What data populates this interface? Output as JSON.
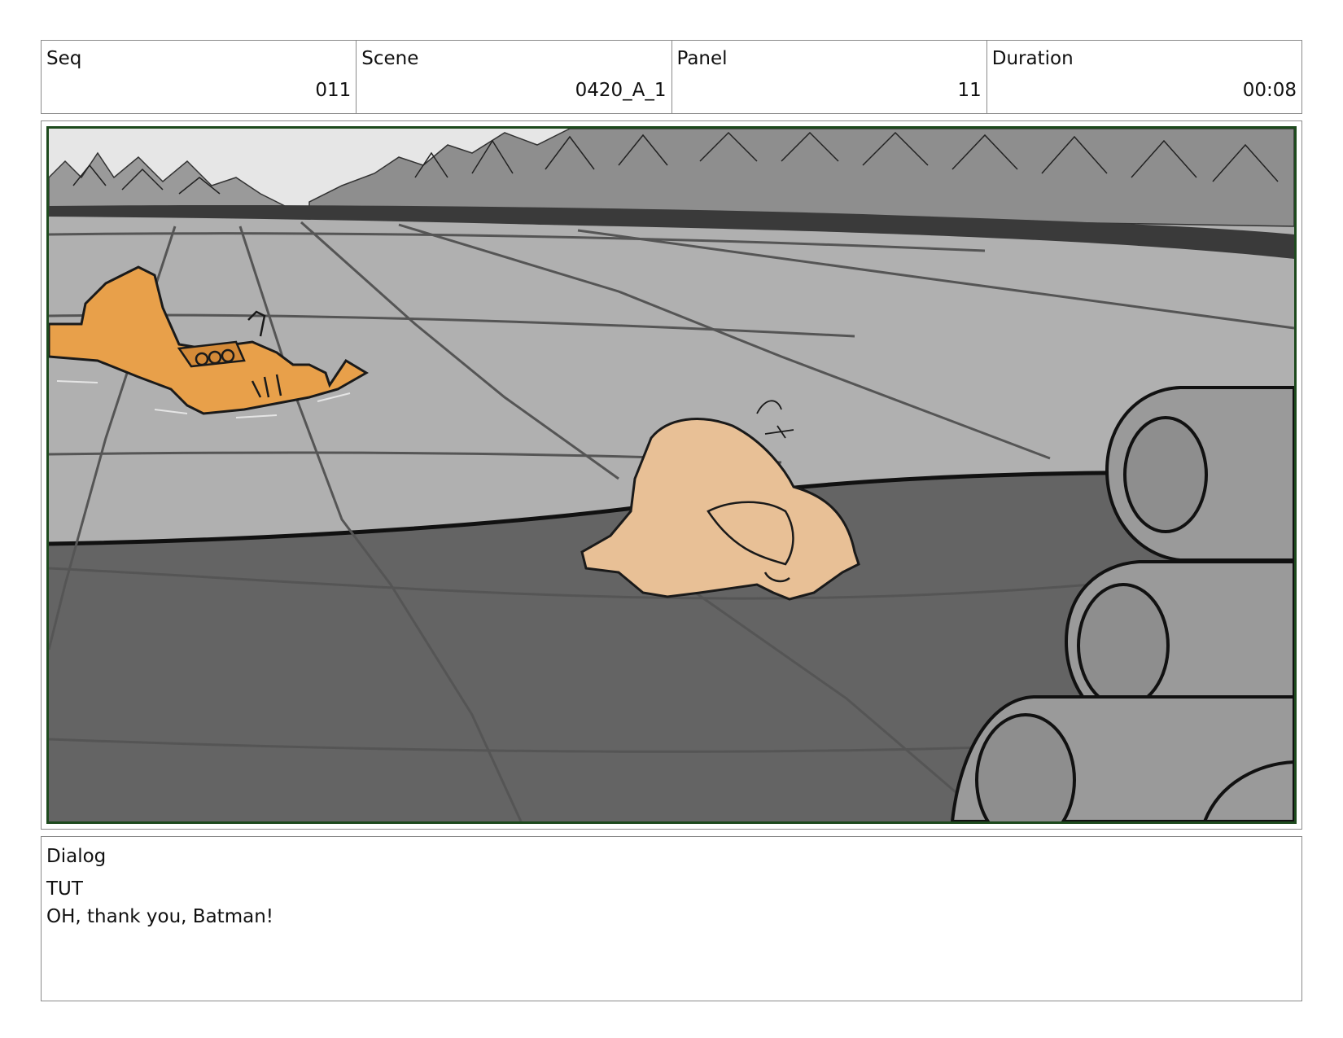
{
  "header": {
    "cells": [
      {
        "label": "Seq",
        "value": "011"
      },
      {
        "label": "Scene",
        "value": "0420_A_1"
      },
      {
        "label": "Panel",
        "value": "11"
      },
      {
        "label": "Duration",
        "value": "00:08"
      }
    ]
  },
  "panel": {
    "frame_color": "#1d4a1d",
    "palette": {
      "ice": "#b0b0b0",
      "dark_ice": "#646464",
      "sky": "#e6e6e6",
      "vehicle": "#e8a04a",
      "character": "#e8c096"
    }
  },
  "dialog": {
    "label": "Dialog",
    "speaker": "TUT",
    "line": "OH, thank you, Batman!"
  }
}
